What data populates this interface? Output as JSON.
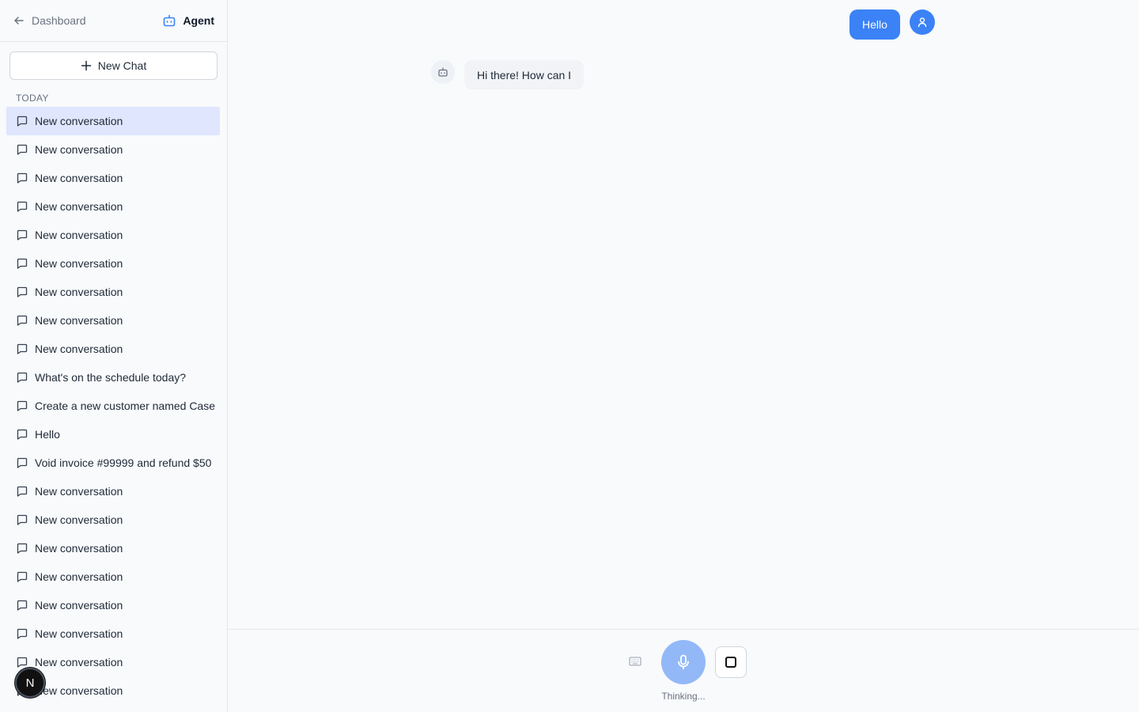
{
  "sidebar": {
    "back_label": "Dashboard",
    "agent_label": "Agent",
    "new_chat_label": "New Chat",
    "section_label": "TODAY",
    "conversations": [
      "New conversation",
      "New conversation",
      "New conversation",
      "New conversation",
      "New conversation",
      "New conversation",
      "New conversation",
      "New conversation",
      "New conversation",
      "What's on the schedule today?",
      "Create a new customer named Case",
      "Hello",
      "Void invoice #99999 and refund $50",
      "New conversation",
      "New conversation",
      "New conversation",
      "New conversation",
      "New conversation",
      "New conversation",
      "New conversation",
      "New conversation"
    ],
    "active_index": 0,
    "user_initial": "N"
  },
  "chat": {
    "user_message": "Hello",
    "bot_message": "Hi there! How can I"
  },
  "controls": {
    "status_text": "Thinking..."
  },
  "colors": {
    "accent": "#3b82f6",
    "active_item_bg": "#dfe6fd",
    "mic_bg": "#93b8f8"
  }
}
